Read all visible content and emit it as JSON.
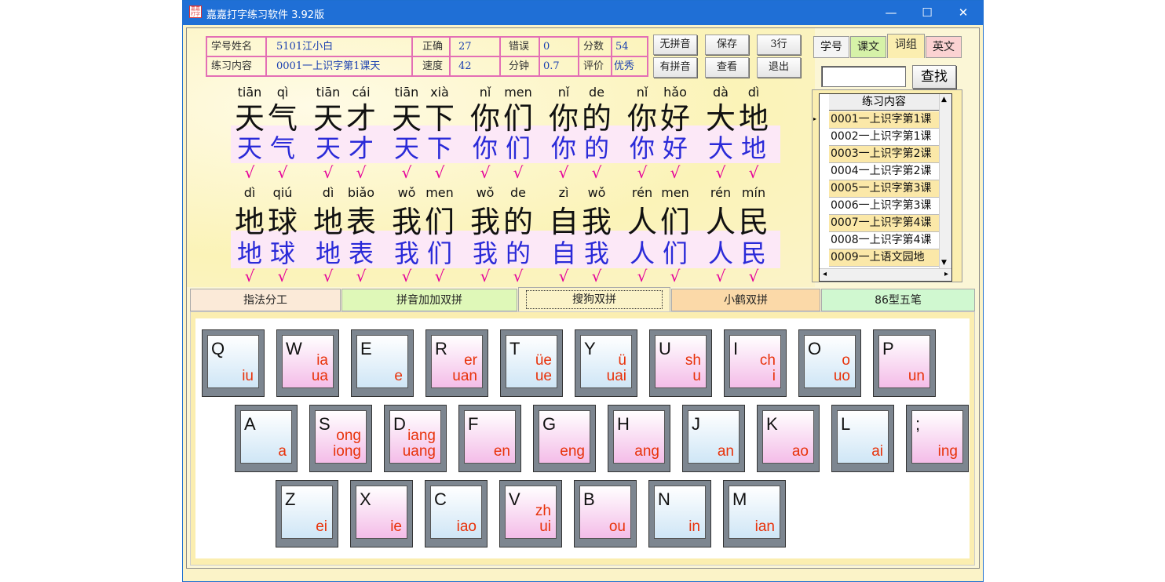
{
  "window": {
    "title": "嘉嘉打字练习软件  3.92版",
    "icon_text": "嘉嘉打字"
  },
  "info": {
    "student_label": "学号姓名",
    "student_value": "5101江小白",
    "correct_label": "正确",
    "correct_value": "27",
    "error_label": "错误",
    "error_value": "0",
    "score_label": "分数",
    "score_value": "54",
    "content_label": "练习内容",
    "content_value": "0001一上识字第1课天",
    "speed_label": "速度",
    "speed_value": "42",
    "minutes_label": "分钟",
    "minutes_value": "0.7",
    "rating_label": "评价",
    "rating_value": "优秀"
  },
  "buttons": {
    "no_pinyin": "无拼音",
    "save": "保存",
    "rows3": "3行",
    "with_pinyin": "有拼音",
    "view": "查看",
    "exit": "退出",
    "search": "查找"
  },
  "right_tabs": [
    "学号",
    "课文",
    "词组",
    "英文"
  ],
  "list": {
    "header": "练习内容",
    "rows": [
      "0001一上识字第1课",
      "0002一上识字第1课",
      "0003一上识字第2课",
      "0004一上识字第2课",
      "0005一上识字第3课",
      "0006一上识字第3课",
      "0007一上识字第4课",
      "0008一上识字第4课",
      "0009一上语文园地"
    ]
  },
  "practice": {
    "line1": [
      {
        "py": [
          "tiān",
          "qì"
        ],
        "hz": [
          "天",
          "气"
        ]
      },
      {
        "py": [
          "tiān",
          "cái"
        ],
        "hz": [
          "天",
          "才"
        ]
      },
      {
        "py": [
          "tiān",
          "xià"
        ],
        "hz": [
          "天",
          "下"
        ]
      },
      {
        "py": [
          "nǐ",
          "men"
        ],
        "hz": [
          "你",
          "们"
        ]
      },
      {
        "py": [
          "nǐ",
          "de"
        ],
        "hz": [
          "你",
          "的"
        ]
      },
      {
        "py": [
          "nǐ",
          "hǎo"
        ],
        "hz": [
          "你",
          "好"
        ]
      },
      {
        "py": [
          "dà",
          "dì"
        ],
        "hz": [
          "大",
          "地"
        ]
      }
    ],
    "line2": [
      {
        "py": [
          "dì",
          "qiú"
        ],
        "hz": [
          "地",
          "球"
        ]
      },
      {
        "py": [
          "dì",
          "biǎo"
        ],
        "hz": [
          "地",
          "表"
        ]
      },
      {
        "py": [
          "wǒ",
          "men"
        ],
        "hz": [
          "我",
          "们"
        ]
      },
      {
        "py": [
          "wǒ",
          "de"
        ],
        "hz": [
          "我",
          "的"
        ]
      },
      {
        "py": [
          "zì",
          "wǒ"
        ],
        "hz": [
          "自",
          "我"
        ]
      },
      {
        "py": [
          "rén",
          "men"
        ],
        "hz": [
          "人",
          "们"
        ]
      },
      {
        "py": [
          "rén",
          "mín"
        ],
        "hz": [
          "人",
          "民"
        ]
      }
    ],
    "check": "√"
  },
  "bottom_tabs": [
    "指法分工",
    "拼音加加双拼",
    "搜狗双拼",
    "小鹤双拼",
    "86型五笔"
  ],
  "keyboard": {
    "row1": [
      {
        "k": "Q",
        "a": "",
        "b": "iu",
        "c": "blue"
      },
      {
        "k": "W",
        "a": "ia",
        "b": "ua",
        "c": "pink"
      },
      {
        "k": "E",
        "a": "",
        "b": "e",
        "c": "blue"
      },
      {
        "k": "R",
        "a": "er",
        "b": "uan",
        "c": "pink"
      },
      {
        "k": "T",
        "a": "üe",
        "b": "ue",
        "c": "blue"
      },
      {
        "k": "Y",
        "a": "ü",
        "b": "uai",
        "c": "blue"
      },
      {
        "k": "U",
        "a": "sh",
        "b": "u",
        "c": "pink"
      },
      {
        "k": "I",
        "a": "ch",
        "b": "i",
        "c": "pink"
      },
      {
        "k": "O",
        "a": "o",
        "b": "uo",
        "c": "blue"
      },
      {
        "k": "P",
        "a": "",
        "b": "un",
        "c": "pink"
      }
    ],
    "row2": [
      {
        "k": "A",
        "a": "",
        "b": "a",
        "c": "blue"
      },
      {
        "k": "S",
        "a": "ong",
        "b": "iong",
        "c": "pink"
      },
      {
        "k": "D",
        "a": "iang",
        "b": "uang",
        "c": "pink"
      },
      {
        "k": "F",
        "a": "",
        "b": "en",
        "c": "pink"
      },
      {
        "k": "G",
        "a": "",
        "b": "eng",
        "c": "pink"
      },
      {
        "k": "H",
        "a": "",
        "b": "ang",
        "c": "pink"
      },
      {
        "k": "J",
        "a": "",
        "b": "an",
        "c": "blue"
      },
      {
        "k": "K",
        "a": "",
        "b": "ao",
        "c": "pink"
      },
      {
        "k": "L",
        "a": "",
        "b": "ai",
        "c": "blue"
      },
      {
        "k": ";",
        "a": "",
        "b": "ing",
        "c": "pink"
      }
    ],
    "row3": [
      {
        "k": "Z",
        "a": "",
        "b": "ei",
        "c": "blue"
      },
      {
        "k": "X",
        "a": "",
        "b": "ie",
        "c": "pink"
      },
      {
        "k": "C",
        "a": "",
        "b": "iao",
        "c": "blue"
      },
      {
        "k": "V",
        "a": "zh",
        "b": "ui",
        "c": "pink"
      },
      {
        "k": "B",
        "a": "",
        "b": "ou",
        "c": "pink"
      },
      {
        "k": "N",
        "a": "",
        "b": "in",
        "c": "blue"
      },
      {
        "k": "M",
        "a": "",
        "b": "ian",
        "c": "blue"
      }
    ]
  }
}
